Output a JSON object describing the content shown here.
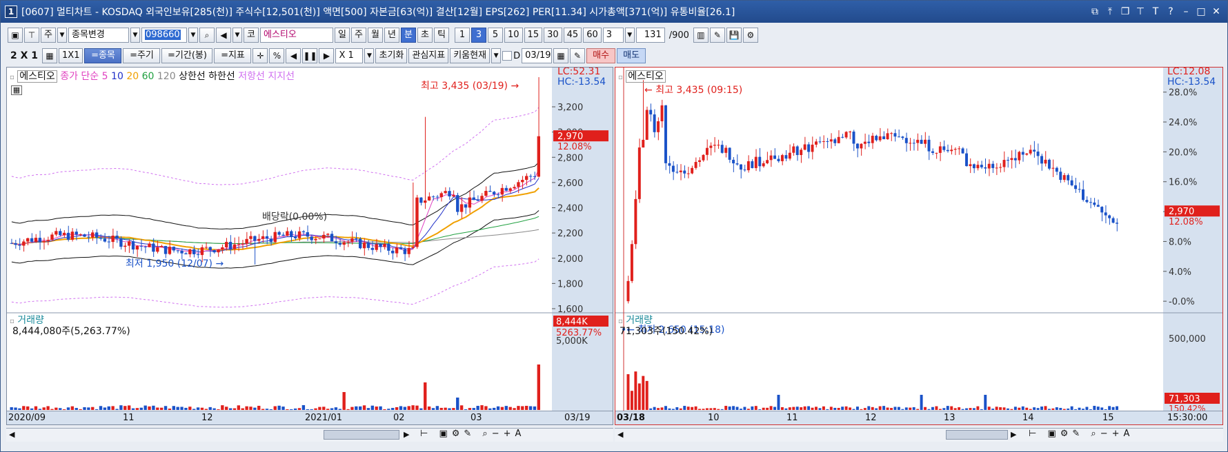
{
  "window": {
    "title_num": "1",
    "title": "[0607] 멀티차트 - KOSDAQ 외국인보유[285(천)] 주식수[12,501(천)] 액면[500] 자본금[63(억)] 결산[12월] EPS[262] PER[11.34] 시가총액[371(억)] 유통비율[26.1]"
  },
  "toolbar1": {
    "period_label": "주",
    "stock_change_label": "종목변경",
    "code_value": "098660",
    "market_label": "코",
    "stock_name": "에스티오",
    "day_label": "일",
    "week_label": "주",
    "month_label": "월",
    "year_label": "년",
    "minute_label": "분",
    "second_label": "초",
    "tick_label": "틱",
    "n1": "1",
    "n3": "3",
    "n5": "5",
    "n10": "10",
    "n15": "15",
    "n30": "30",
    "n45": "45",
    "n60": "60",
    "interval_value": "3",
    "count_value": "131",
    "count_max": "/900"
  },
  "toolbar2": {
    "layout_label": "2 X 1",
    "one_by_one": "1X1",
    "same_stock": "=종목",
    "same_period": "=주기",
    "same_range": "=기간(봉)",
    "same_indicator": "=지표",
    "zoom_value": "X 1",
    "reset_label": "초기화",
    "watch_label": "관심지표",
    "kiwoom_label": "키움현재",
    "date_value": "03/19",
    "buy_label": "매수",
    "sell_label": "매도"
  },
  "left_chart": {
    "stock": "에스티오",
    "legend": {
      "close": "종가 단순",
      "ma5": "5",
      "ma10": "10",
      "ma20": "20",
      "ma60": "60",
      "ma120": "120",
      "upper": "상한선",
      "lower": "하한선",
      "resist": "저항선",
      "support": "지지선"
    },
    "max_label": "최고 3,435 (03/19)",
    "min_label": "최저 1,950 (12/07)",
    "dividend_label": "배당락(0.00%)",
    "lc": "LC:52.31",
    "hc": "HC:-13.54",
    "y_ticks": [
      "3,200",
      "3,000",
      "2,800",
      "2,600",
      "2,400",
      "2,200",
      "2,000",
      "1,800",
      "1,600"
    ],
    "cur_price": "2,970",
    "cur_pct": "12.08%",
    "vol_title": "거래량",
    "vol_value": "8,444,080주(5,263.77%)",
    "vol_badge": "8,444K",
    "vol_pct": "5263.77%",
    "vol_tick": "5,000K",
    "x_labels": [
      "2020/09",
      "11",
      "12",
      "2021/01",
      "02",
      "03"
    ],
    "x_right": "03/19"
  },
  "right_chart": {
    "stock": "에스티오",
    "max_label": "최고 3,435 (09:15)",
    "min_label": "최저 2,650 (15:18)",
    "lc": "LC:12.08",
    "hc": "HC:-13.54",
    "y_ticks": [
      "28.0%",
      "24.0%",
      "20.0%",
      "16.0%",
      "12.0%",
      "8.0%",
      "4.0%",
      "-0.0%"
    ],
    "cur_price": "2,970",
    "cur_pct": "12.08%",
    "vol_title": "거래량",
    "vol_value": "71,303주(150.42%)",
    "vol_tick": "500,000",
    "vol_badge": "71,303",
    "vol_pct": "150.42%",
    "x_labels": [
      "03/18",
      "10",
      "11",
      "12",
      "13",
      "14",
      "15"
    ],
    "x_right": "15:30:00"
  },
  "chart_data": [
    {
      "type": "candlestick",
      "title": "에스티오",
      "y_ticks": [
        1600,
        1800,
        2000,
        2200,
        2400,
        2600,
        2800,
        3000,
        3200
      ],
      "ylim": [
        1600,
        3435
      ],
      "max": 3435,
      "min": 1950,
      "last": 2970
    },
    {
      "type": "candlestick",
      "title": "에스티오",
      "y_ticks": [
        0,
        4,
        8,
        12,
        16,
        20,
        24,
        28
      ],
      "max": 3435,
      "min": 2650,
      "last": 2970
    }
  ],
  "colors": {
    "up": "#e0201c",
    "down": "#1a52c8",
    "ma5": "#e040c0",
    "ma10": "#2030c8",
    "ma20": "#f0a000",
    "ma60": "#20a040",
    "ma120": "#888888",
    "band": "#101010",
    "envelope": "#d070f0"
  }
}
